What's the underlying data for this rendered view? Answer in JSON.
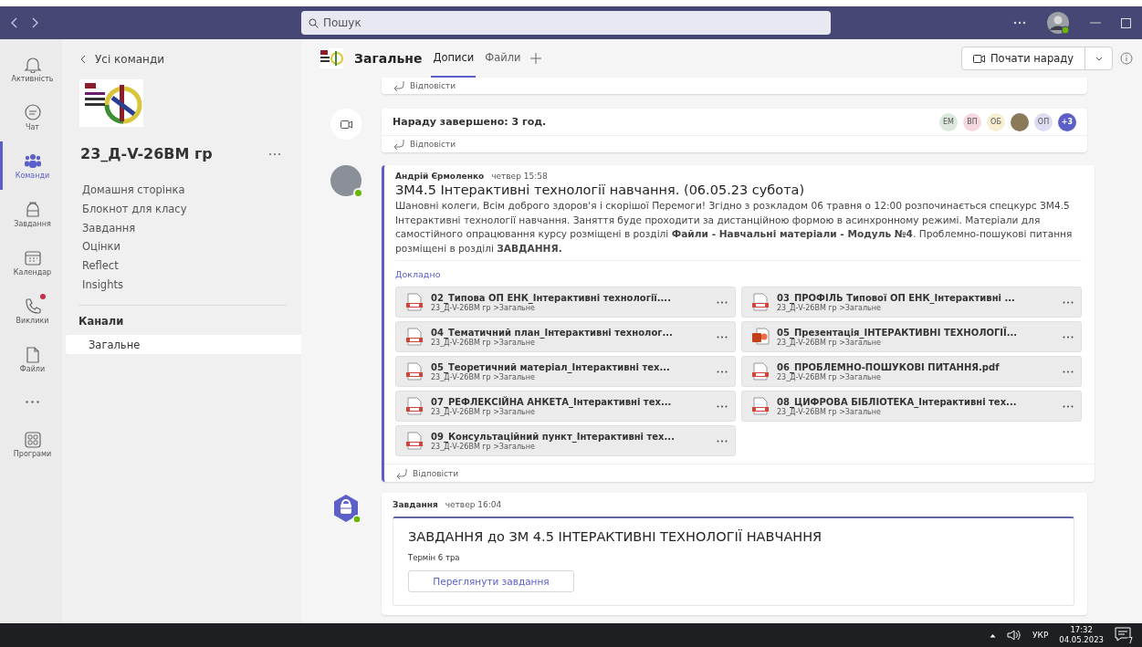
{
  "title_bar": {
    "search": {
      "placeholder": "Пошук"
    }
  },
  "rail": [
    {
      "label": "Активність",
      "kind": "bell",
      "selected": false,
      "badge": false
    },
    {
      "label": "Чат",
      "kind": "chat",
      "selected": false,
      "badge": false
    },
    {
      "label": "Команди",
      "kind": "teams",
      "selected": true,
      "badge": false
    },
    {
      "label": "Завдання",
      "kind": "bag",
      "selected": false,
      "badge": false
    },
    {
      "label": "Календар",
      "kind": "calendar",
      "selected": false,
      "badge": false
    },
    {
      "label": "Виклики",
      "kind": "phone",
      "selected": false,
      "badge": true
    },
    {
      "label": "Файли",
      "kind": "file",
      "selected": false,
      "badge": false
    },
    {
      "kind": "more",
      "selected": false,
      "badge": false
    },
    {
      "label": "Програми",
      "kind": "apps",
      "selected": false,
      "badge": false
    }
  ],
  "sidebar": {
    "back": "Усі команди",
    "team_name": "23_Д-V-26ВМ гр",
    "items": [
      "Домашня сторінка",
      "Блокнот для класу",
      "Завдання",
      "Оцінки",
      "Reflect",
      "Insights"
    ],
    "channels_heading": "Канали",
    "channels": [
      {
        "label": "Загальне",
        "selected": true
      }
    ]
  },
  "channel_header": {
    "name": "Загальне",
    "tabs": [
      {
        "label": "Дописи",
        "selected": true
      },
      {
        "label": "Файли",
        "selected": false
      }
    ],
    "meet_button": "Почати нараду"
  },
  "feed": {
    "top_reply": "Відповісти",
    "meeting": {
      "text": "Нараду завершено: 3 год.",
      "reply": "Відповісти",
      "participants": [
        {
          "kind": "initials",
          "initials": "ЕМ",
          "color": "#dde8dc"
        },
        {
          "kind": "initials",
          "initials": "ВП",
          "color": "#f6d9de"
        },
        {
          "kind": "initials",
          "initials": "ОБ",
          "color": "#f8efd2"
        },
        {
          "kind": "photo",
          "color": "#8a7a5a"
        },
        {
          "kind": "initials",
          "initials": "ОП",
          "color": "#dedcf1"
        },
        {
          "kind": "count",
          "initials": "+3",
          "color": "#5b5fc7"
        }
      ]
    },
    "post": {
      "author": "Андрій Єрмоленко",
      "time": "четвер 15:58",
      "title": "ЗМ4.5 Інтерактивні технології навчання. (06.05.23 субота)",
      "body": "Шановні колеги, Всім доброго здоров'я і скорішої Перемоги! Згідно з розкладом 06 травня о 12:00 розпочинається спецкурс ЗМ4.5 Інтерактивні технології навчання. Заняття буде проходити за дистанційною формою в асинхронному режимі. Матеріали для самостійного опрацювання курсу розміщені в розділі **Файли - Навчальні матеріали - Модуль №4**. Проблемно-пошукові питання розміщені в розділі **ЗАВДАННЯ.**",
      "more_link": "Докладно",
      "attachments": [
        {
          "name": "02_Типова ОП ЕНК_Інтерактивні технології....",
          "location": "23_Д-V-26ВМ гр >Загальне",
          "kind": "doc"
        },
        {
          "name": "03_ПРОФІЛЬ Типової ОП ЕНК_Інтерактивні ...",
          "location": "23_Д-V-26ВМ гр >Загальне",
          "kind": "doc"
        },
        {
          "name": "04_Тематичний план_Інтерактивні технолог...",
          "location": "23_Д-V-26ВМ гр >Загальне",
          "kind": "doc"
        },
        {
          "name": "05_Презентація_ІНТЕРАКТИВНІ ТЕХНОЛОГІЇ...",
          "location": "23_Д-V-26ВМ гр >Загальне",
          "kind": "ppt"
        },
        {
          "name": "05_Теоретичний матеріал_Інтерактивні тех...",
          "location": "23_Д-V-26ВМ гр >Загальне",
          "kind": "doc"
        },
        {
          "name": "06_ПРОБЛЕМНО-ПОШУКОВІ ПИТАННЯ.pdf",
          "location": "23_Д-V-26ВМ гр >Загальне",
          "kind": "doc"
        },
        {
          "name": "07_РЕФЛЕКСІЙНА АНКЕТА_Інтерактивні тех...",
          "location": "23_Д-V-26ВМ гр >Загальне",
          "kind": "doc"
        },
        {
          "name": "08_ЦИФРОВА БІБЛІОТЕКА_Інтерактивні тех...",
          "location": "23_Д-V-26ВМ гр >Загальне",
          "kind": "doc"
        },
        {
          "name": "09_Консультаційний пункт_Інтерактивні тех...",
          "location": "23_Д-V-26ВМ гр >Загальне",
          "kind": "doc"
        }
      ],
      "reply": "Відповісти"
    },
    "task": {
      "author": "Завдання",
      "time": "четвер 16:04",
      "title": "ЗАВДАННЯ до ЗМ 4.5 ІНТЕРАКТИВНІ ТЕХНОЛОГІЇ НАВЧАННЯ",
      "due": "Термін 6 тра",
      "button": "Переглянути завдання"
    }
  },
  "taskbar": {
    "language": "УКР",
    "time": "17:32",
    "date": "04.05.2023",
    "notifications": "7"
  }
}
